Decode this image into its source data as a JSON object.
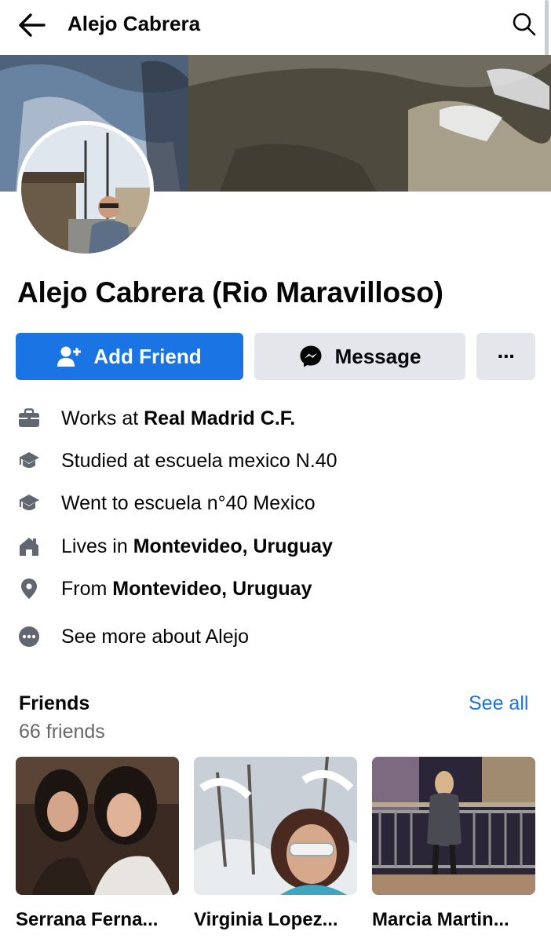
{
  "header": {
    "title": "Alejo Cabrera",
    "back_icon": "arrow-left-icon",
    "search_icon": "search-icon"
  },
  "profile": {
    "name": "Alejo Cabrera (Rio Maravilloso)"
  },
  "actions": {
    "add_friend_label": "Add Friend",
    "message_label": "Message",
    "more_label": "···"
  },
  "about": [
    {
      "icon": "briefcase-icon",
      "prefix": "Works at ",
      "bold": "Real Madrid C.F."
    },
    {
      "icon": "graduation-cap-icon",
      "prefix": "Studied at escuela mexico N.40",
      "bold": ""
    },
    {
      "icon": "graduation-cap-icon",
      "prefix": "Went to escuela n°40 Mexico",
      "bold": ""
    },
    {
      "icon": "home-icon",
      "prefix": "Lives in ",
      "bold": "Montevideo, Uruguay"
    },
    {
      "icon": "location-pin-icon",
      "prefix": "From ",
      "bold": "Montevideo, Uruguay"
    },
    {
      "icon": "more-dots-icon",
      "prefix": "See more about Alejo",
      "bold": ""
    }
  ],
  "friends": {
    "title": "Friends",
    "count": "66 friends",
    "see_all": "See all",
    "items": [
      {
        "name": "Serrana Ferna..."
      },
      {
        "name": "Virginia Lopez..."
      },
      {
        "name": "Marcia Martin..."
      }
    ]
  },
  "colors": {
    "accent": "#1b74e4",
    "button_gray": "#e4e6eb",
    "secondary_text": "#65676b"
  }
}
